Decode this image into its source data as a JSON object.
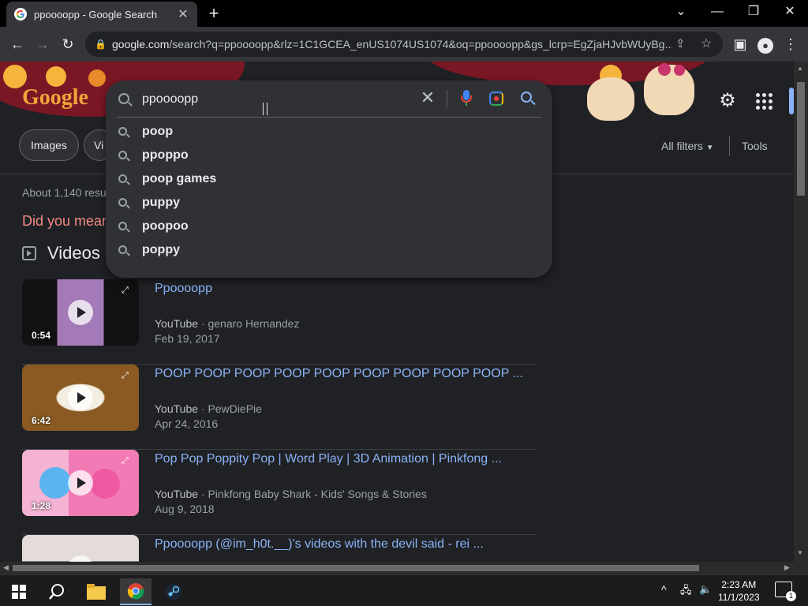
{
  "browser": {
    "tab_title": "ppoooopp - Google Search",
    "url_domain": "google.com",
    "url_path": "/search?q=ppoooopp&rlz=1C1GCEA_enUS1074US1074&oq=ppoooopp&gs_lcrp=EgZjaHJvbWUyBg..."
  },
  "google": {
    "logo_text": "Google",
    "chips": [
      "Images",
      "Vi"
    ],
    "all_filters": "All filters",
    "tools": "Tools"
  },
  "search": {
    "query": "ppoooopp",
    "suggestions": [
      "poop",
      "ppoppo",
      "poop games",
      "puppy",
      "poopoo",
      "poppy"
    ]
  },
  "results": {
    "stats": "About 1,140 resu",
    "did_you_mean": "Did you mean",
    "videos_heading": "Videos",
    "videos": [
      {
        "title": "Ppoooopp",
        "source": "YouTube",
        "channel": "genaro Hernandez",
        "date": "Feb 19, 2017",
        "duration": "0:54",
        "thumb_color": "#a37ab7"
      },
      {
        "title": "POOP POOP POOP POOP POOP POOP POOP POOP POOP ...",
        "source": "YouTube",
        "channel": "PewDiePie",
        "date": "Apr 24, 2016",
        "duration": "6:42",
        "thumb_color": "#8a5a22"
      },
      {
        "title": "Pop Pop Poppity Pop | Word Play | 3D Animation | Pinkfong ...",
        "source": "YouTube",
        "channel": "Pinkfong Baby Shark - Kids' Songs & Stories",
        "date": "Aug 9, 2018",
        "duration": "1:28",
        "thumb_color": "#f27bb5"
      },
      {
        "title": "Ppoooopp (@im_h0t.__)'s videos with the devil said - rei ...",
        "source": "",
        "channel": "",
        "date": "",
        "duration": "",
        "thumb_color": "#d8d2cf"
      }
    ]
  },
  "taskbar": {
    "time": "2:23 AM",
    "date": "11/1/2023",
    "notification_count": "1"
  },
  "colors": {
    "accent": "#8ab4f8",
    "did_you_mean": "#f28b82"
  }
}
